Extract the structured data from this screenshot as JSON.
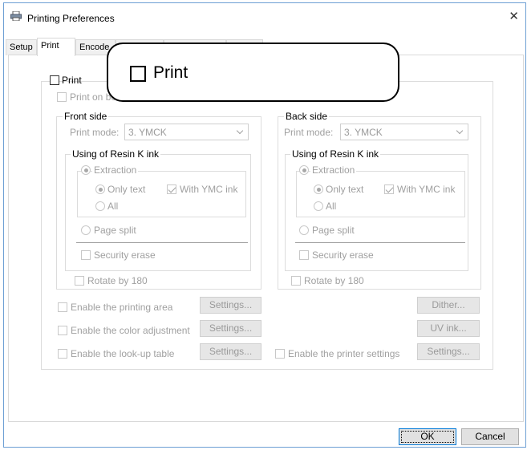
{
  "window": {
    "title": "Printing Preferences",
    "close_glyph": "✕"
  },
  "tabs": [
    {
      "label": "Setup"
    },
    {
      "label": "Print"
    },
    {
      "label": "Encode"
    }
  ],
  "callout": {
    "label": "Print"
  },
  "print_group": {
    "legend": "Print",
    "checked": false,
    "print_on_both": "Print on bo"
  },
  "front_side": {
    "legend": "Front side",
    "print_mode_label": "Print mode:",
    "print_mode_value": "3. YMCK",
    "resin_legend": "Using of Resin K ink",
    "extraction_label": "Extraction",
    "only_text_label": "Only text",
    "with_ymc_label": "With YMC ink",
    "all_label": "All",
    "page_split_label": "Page split",
    "security_erase_label": "Security erase",
    "rotate_label": "Rotate by 180"
  },
  "back_side": {
    "legend": "Back side",
    "print_mode_label": "Print mode:",
    "print_mode_value": "3. YMCK",
    "resin_legend": "Using of Resin K ink",
    "extraction_label": "Extraction",
    "only_text_label": "Only text",
    "with_ymc_label": "With YMC ink",
    "all_label": "All",
    "page_split_label": "Page split",
    "security_erase_label": "Security erase",
    "rotate_label": "Rotate by 180"
  },
  "options": {
    "printing_area_label": "Enable the printing area",
    "color_adjustment_label": "Enable the color adjustment",
    "lookup_table_label": "Enable the look-up table",
    "printer_settings_label": "Enable the printer settings",
    "settings_button": "Settings...",
    "dither_button": "Dither...",
    "uv_ink_button": "UV ink..."
  },
  "footer": {
    "ok_label": "OK",
    "cancel_label": "Cancel"
  }
}
